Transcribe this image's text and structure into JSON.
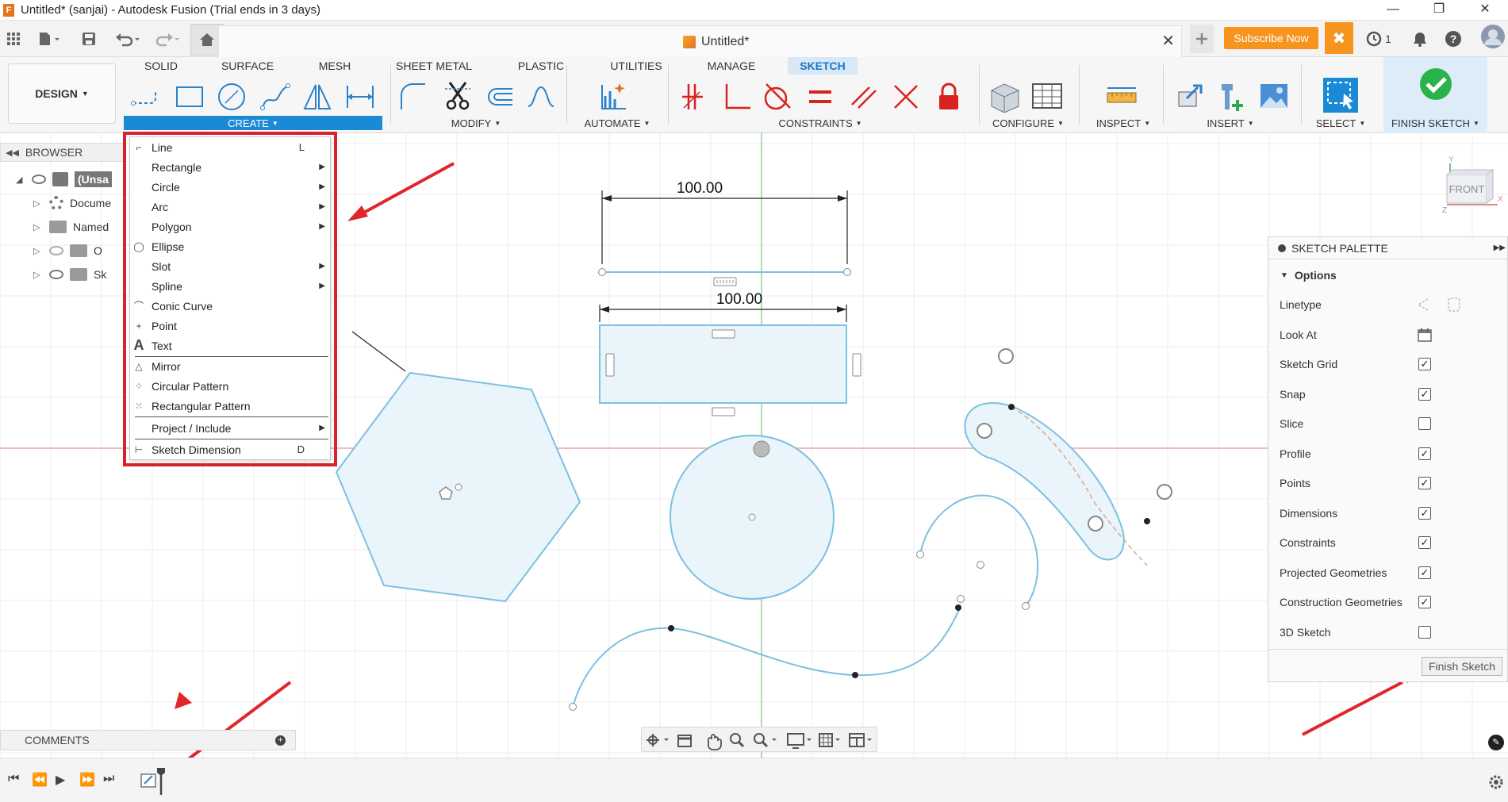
{
  "window": {
    "title": "Untitled* (sanjai) - Autodesk Fusion (Trial ends in 3 days)",
    "app_icon": "F",
    "controls": [
      "—",
      "❐",
      "✕"
    ]
  },
  "quick_access": {
    "doc_tab_title": "Untitled*",
    "subscribe_label": "Subscribe Now",
    "job_count": "1"
  },
  "ribbon": {
    "workspace": "DESIGN",
    "tabs": [
      "SOLID",
      "SURFACE",
      "MESH",
      "SHEET METAL",
      "PLASTIC",
      "UTILITIES",
      "MANAGE",
      "SKETCH"
    ],
    "active_tab": "SKETCH",
    "groups": {
      "create": "CREATE",
      "modify": "MODIFY",
      "automate": "AUTOMATE",
      "constraints": "CONSTRAINTS",
      "configure": "CONFIGURE",
      "inspect": "INSPECT",
      "insert": "INSERT",
      "select": "SELECT",
      "finish": "FINISH SKETCH"
    }
  },
  "browser": {
    "title": "BROWSER",
    "items": [
      {
        "label": "(Unsa"
      },
      {
        "label": "Docume"
      },
      {
        "label": "Named"
      },
      {
        "label": "O"
      },
      {
        "label": "Sk"
      }
    ]
  },
  "create_menu": {
    "items": [
      {
        "label": "Line",
        "key": "L",
        "submenu": false
      },
      {
        "label": "Rectangle",
        "key": "",
        "submenu": true
      },
      {
        "label": "Circle",
        "key": "",
        "submenu": true
      },
      {
        "label": "Arc",
        "key": "",
        "submenu": true
      },
      {
        "label": "Polygon",
        "key": "",
        "submenu": true
      },
      {
        "label": "Ellipse",
        "key": "",
        "submenu": false
      },
      {
        "label": "Slot",
        "key": "",
        "submenu": true
      },
      {
        "label": "Spline",
        "key": "",
        "submenu": true
      },
      {
        "label": "Conic Curve",
        "key": "",
        "submenu": false
      },
      {
        "label": "Point",
        "key": "",
        "submenu": false
      },
      {
        "label": "Text",
        "key": "",
        "submenu": false
      },
      {
        "label": "Mirror",
        "key": "",
        "submenu": false
      },
      {
        "label": "Circular Pattern",
        "key": "",
        "submenu": false
      },
      {
        "label": "Rectangular Pattern",
        "key": "",
        "submenu": false
      },
      {
        "label": "Project / Include",
        "key": "",
        "submenu": true
      },
      {
        "label": "Sketch Dimension",
        "key": "D",
        "submenu": false
      }
    ]
  },
  "canvas": {
    "dimension_top": "100.00",
    "dimension_rect": "100.00",
    "viewcube_label": "FRONT",
    "axis_labels": {
      "y": "Y",
      "x": "X",
      "z": "Z"
    }
  },
  "sketch_palette": {
    "title": "SKETCH PALETTE",
    "section": "Options",
    "options": [
      {
        "label": "Linetype",
        "control": "icon"
      },
      {
        "label": "Look At",
        "control": "icon"
      },
      {
        "label": "Sketch Grid",
        "checked": true
      },
      {
        "label": "Snap",
        "checked": true
      },
      {
        "label": "Slice",
        "checked": false
      },
      {
        "label": "Profile",
        "checked": true
      },
      {
        "label": "Points",
        "checked": true
      },
      {
        "label": "Dimensions",
        "checked": true
      },
      {
        "label": "Constraints",
        "checked": true
      },
      {
        "label": "Projected Geometries",
        "checked": true
      },
      {
        "label": "Construction Geometries",
        "checked": true
      },
      {
        "label": "3D Sketch",
        "checked": false
      }
    ],
    "finish_button": "Finish Sketch"
  },
  "comments": {
    "title": "COMMENTS"
  },
  "colors": {
    "accent": "#1b8ad6",
    "highlight_box": "#d9232a",
    "annotation_arrow": "#e0262a",
    "sketch_line": "#7cc0e2",
    "sketch_fill": "#e9f4fb",
    "subscribe": "#f7941e"
  }
}
